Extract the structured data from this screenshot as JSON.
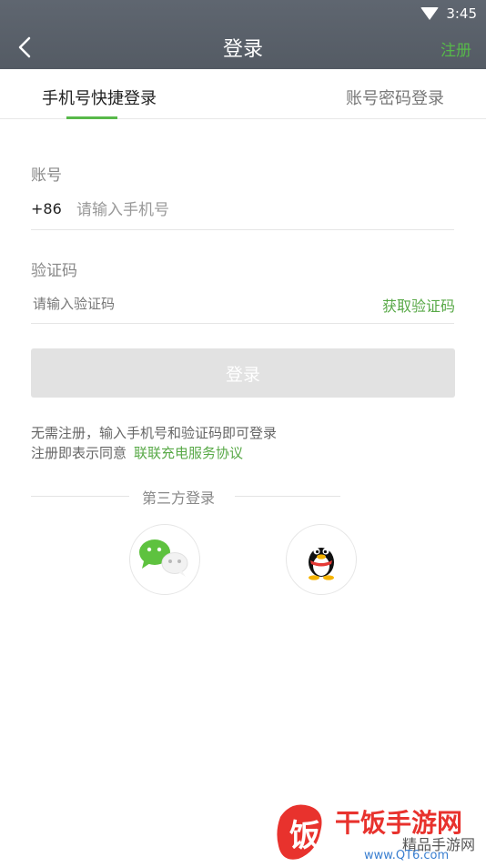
{
  "status": {
    "time": "3:45"
  },
  "header": {
    "title": "登录",
    "register": "注册"
  },
  "tabs": {
    "sms_login": "手机号快捷登录",
    "password_login": "账号密码登录"
  },
  "form": {
    "account_label": "账号",
    "country_code": "+86",
    "phone_placeholder": "请输入手机号",
    "code_label": "验证码",
    "code_placeholder": "请输入验证码",
    "get_code": "获取验证码",
    "login_button": "登录"
  },
  "hints": {
    "line1": "无需注册，输入手机号和验证码即可登录",
    "line2_prefix": "注册即表示同意",
    "agreement_link": "联联充电服务协议"
  },
  "third_party": {
    "title": "第三方登录",
    "providers": [
      "wechat",
      "qq"
    ]
  },
  "watermark": {
    "brand": "干饭手游网",
    "sub": "精品手游网",
    "url": "www.QT6.com"
  },
  "colors": {
    "header_bg": "#596069",
    "accent": "#58b94a",
    "button_disabled": "#e2e2e2"
  }
}
